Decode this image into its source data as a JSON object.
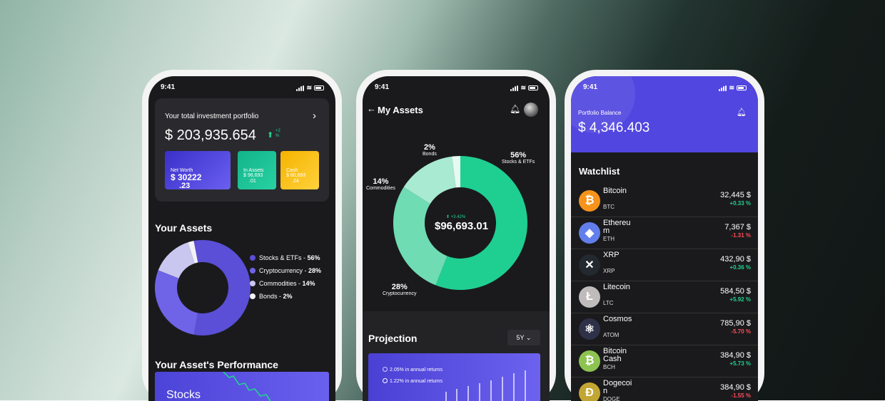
{
  "status_time": "9:41",
  "phone1": {
    "portfolio_label": "Your total investment portfolio",
    "portfolio_value": "$ 203,935.654",
    "portfolio_change_top": "+2",
    "portfolio_change_bottom": "%",
    "cards": [
      {
        "label": "Net Worth",
        "value": "$ 30222",
        "value2": ".23"
      },
      {
        "label": "In Assets",
        "value": "$ 96,693",
        "value2": ".01"
      },
      {
        "label": "Cash",
        "value": "$ 80,693",
        "value2": ".24"
      }
    ],
    "assets_title": "Your Assets",
    "legend": [
      {
        "name": "Stocks & ETFs",
        "pct": "56%",
        "color": "#5a4fd6"
      },
      {
        "name": "Cryptocurrency",
        "pct": "28%",
        "color": "#6f63e8"
      },
      {
        "name": "Commodities",
        "pct": "14%",
        "color": "#c9c6ef"
      },
      {
        "name": "Bonds",
        "pct": "2%",
        "color": "#f2f2f6"
      }
    ],
    "donut": [
      56,
      28,
      14,
      2
    ],
    "performance_title": "Your Asset's Performance",
    "performance_card_label": "Stocks"
  },
  "phone2": {
    "title": "My Assets",
    "center_change": "+3.42%",
    "center_value": "$96,693.01",
    "labels": [
      {
        "pct": "56%",
        "name": "Stocks & ETFs"
      },
      {
        "pct": "28%",
        "name": "Cryptocurrency"
      },
      {
        "pct": "14%",
        "name": "Commodities"
      },
      {
        "pct": "2%",
        "name": "Bonds"
      }
    ],
    "donut": [
      56,
      28,
      14,
      2
    ],
    "projection_title": "Projection",
    "period": "5Y",
    "proj_items": [
      "2.05% in annual returns",
      "1.22% in annual returns"
    ]
  },
  "phone3": {
    "balance_label": "Portfolio Balance",
    "balance_value": "$ 4,346.403",
    "watchlist_title": "Watchlist",
    "items": [
      {
        "name": "Bitcoin",
        "sym": "BTC",
        "price": "32,445 $",
        "change": "+0.33 %",
        "dir": "up",
        "icon": "bitcoin-icon",
        "color": "#f7931a",
        "glyph": "₿"
      },
      {
        "name": "Ethereum",
        "sym": "ETH",
        "price": "7,367 $",
        "change": "-1.31 %",
        "dir": "down",
        "icon": "ethereum-icon",
        "color": "#627eea",
        "glyph": "◆"
      },
      {
        "name": "XRP",
        "sym": "XRP",
        "price": "432,90 $",
        "change": "+0.36 %",
        "dir": "up",
        "icon": "xrp-icon",
        "color": "#23292f",
        "glyph": "✕"
      },
      {
        "name": "Litecoin",
        "sym": "LTC",
        "price": "584,50 $",
        "change": "+5.92 %",
        "dir": "up",
        "icon": "litecoin-icon",
        "color": "#bfbbbb",
        "glyph": "Ł"
      },
      {
        "name": "Cosmos",
        "sym": "ATOM",
        "price": "785,90 $",
        "change": "-5.70 %",
        "dir": "down",
        "icon": "cosmos-icon",
        "color": "#2e3148",
        "glyph": "⚛"
      },
      {
        "name": "Bitcoin Cash",
        "sym": "BCH",
        "price": "384,90 $",
        "change": "+5.73 %",
        "dir": "up",
        "icon": "bitcoin-cash-icon",
        "color": "#8dc351",
        "glyph": "₿"
      },
      {
        "name": "Dogecoin",
        "sym": "DOGE",
        "price": "384,90 $",
        "change": "-1.55 %",
        "dir": "down",
        "icon": "dogecoin-icon",
        "color": "#c2a633",
        "glyph": "Ð"
      }
    ]
  }
}
